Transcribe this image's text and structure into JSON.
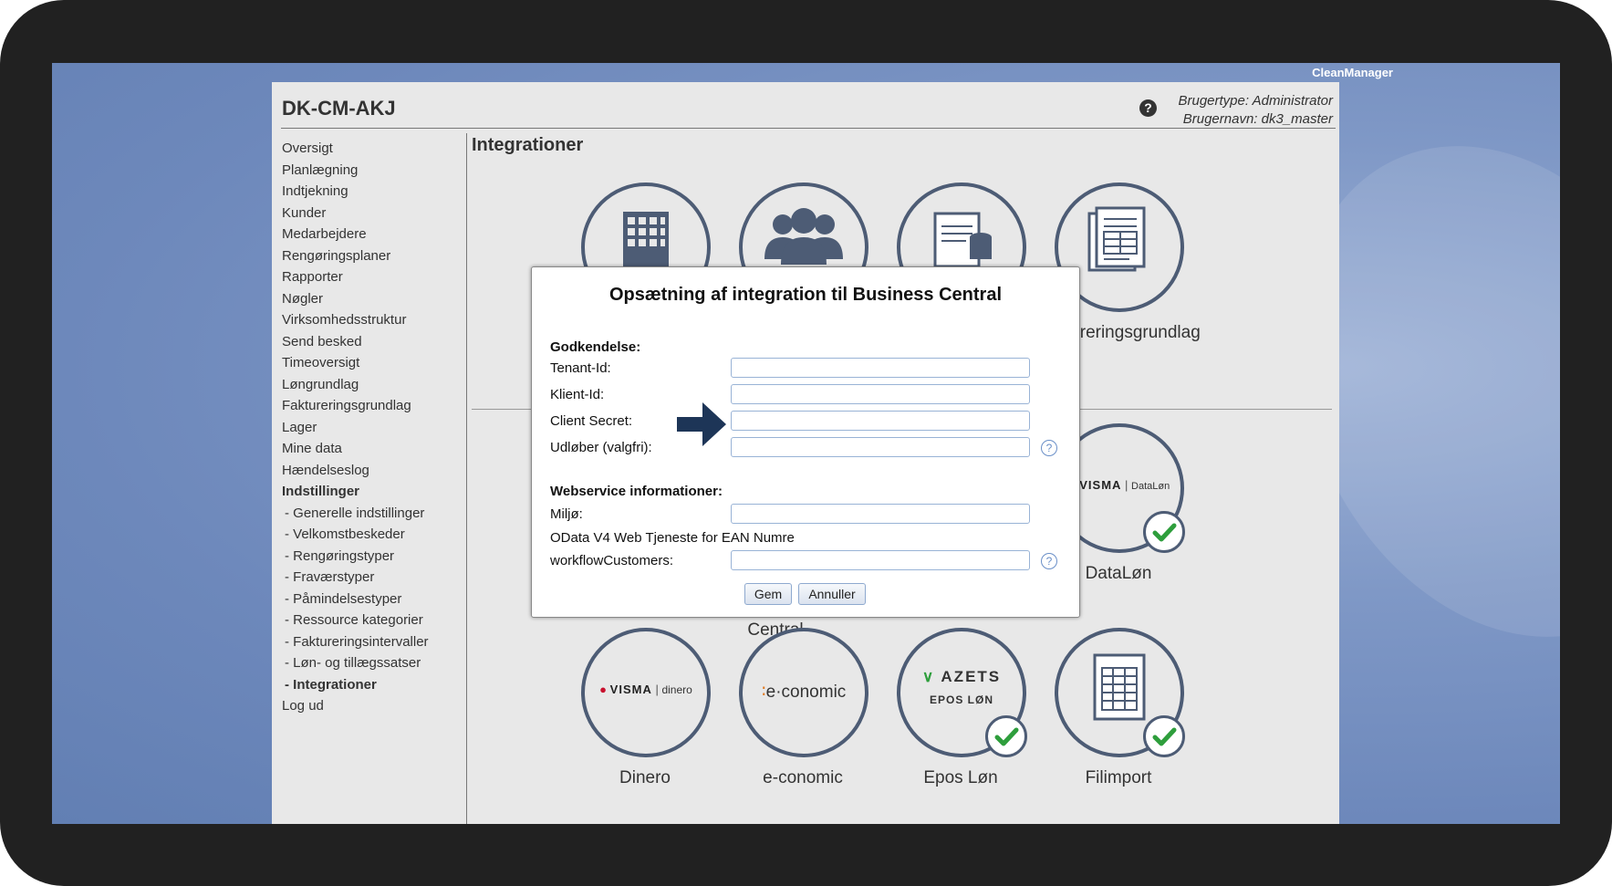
{
  "desktop": {
    "brand": "CleanManager"
  },
  "header": {
    "site_title": "DK-CM-AKJ",
    "user_type": "Brugertype: Administrator",
    "user_name": "Brugernavn: dk3_master",
    "help_glyph": "?"
  },
  "sidebar": {
    "items": [
      {
        "label": "Oversigt"
      },
      {
        "label": "Planlægning"
      },
      {
        "label": "Indtjekning"
      },
      {
        "label": "Kunder"
      },
      {
        "label": "Medarbejdere"
      },
      {
        "label": "Rengøringsplaner"
      },
      {
        "label": "Rapporter"
      },
      {
        "label": "Nøgler"
      },
      {
        "label": "Virksomhedsstruktur"
      },
      {
        "label": "Send besked"
      },
      {
        "label": "Timeoversigt"
      },
      {
        "label": "Løngrundlag"
      },
      {
        "label": "Faktureringsgrundlag"
      },
      {
        "label": "Lager"
      },
      {
        "label": "Mine data"
      },
      {
        "label": "Hændelseslog"
      },
      {
        "label": "Indstillinger"
      },
      {
        "label": "- Generelle indstillinger"
      },
      {
        "label": "- Velkomstbeskeder"
      },
      {
        "label": "- Rengøringstyper"
      },
      {
        "label": "- Fraværstyper"
      },
      {
        "label": "- Påmindelsestyper"
      },
      {
        "label": "- Ressource kategorier"
      },
      {
        "label": "- Faktureringsintervaller"
      },
      {
        "label": "- Løn- og tillægssatser"
      },
      {
        "label": "- Integrationer"
      },
      {
        "label": "Log ud"
      }
    ]
  },
  "main": {
    "page_title": "Integrationer",
    "tiles": {
      "building": {
        "icon": "building-icon"
      },
      "people": {
        "icon": "people-icon"
      },
      "docs": {
        "icon": "document-database-icon"
      },
      "faktura": {
        "label": "Faktureringsgrundlag",
        "icon": "invoice-document-icon"
      },
      "bc_partial_label": "Central",
      "datalon": {
        "label": "DataLøn",
        "logo_brand": "VISMA",
        "logo_product": "DataLøn"
      },
      "dinero": {
        "label": "Dinero",
        "logo_brand": "VISMA",
        "logo_product": "dinero"
      },
      "economic": {
        "label": "e-conomic",
        "logo_text": "e·conomic"
      },
      "epos": {
        "label": "Epos Løn",
        "logo_brand": "AZETS",
        "logo_product": "EPOS LØN"
      },
      "filimport": {
        "label": "Filimport",
        "icon": "spreadsheet-icon"
      }
    }
  },
  "modal": {
    "title": "Opsætning af integration til Business Central",
    "auth_heading": "Godkendelse:",
    "tenant_label": "Tenant-Id:",
    "client_id_label": "Klient-Id:",
    "client_secret_label": "Client Secret:",
    "expires_label": "Udløber (valgfri):",
    "ws_heading": "Webservice informationer:",
    "env_label": "Miljø:",
    "odata_text": "OData V4 Web Tjeneste for EAN Numre",
    "workflow_label": "workflowCustomers:",
    "save_label": "Gem",
    "cancel_label": "Annuller",
    "help_glyph": "?"
  },
  "colors": {
    "accent": "#4d5c75",
    "check_green": "#2e9e3c",
    "visma_red": "#c8102e",
    "arrow": "#1d3557"
  }
}
